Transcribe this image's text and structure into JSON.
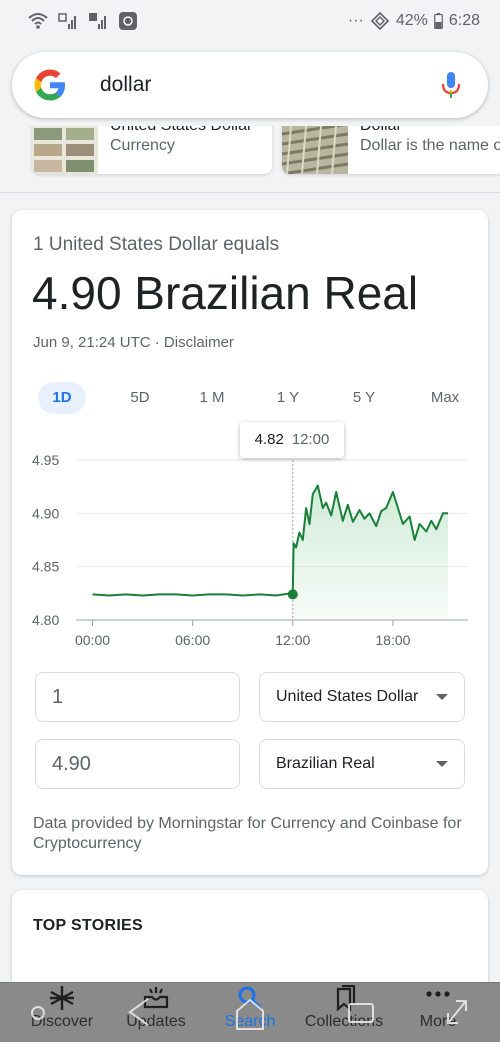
{
  "status_bar": {
    "battery": "42%",
    "time": "6:28",
    "dots": "···"
  },
  "search": {
    "query": "dollar"
  },
  "knowledge_cards": [
    {
      "title": "United States Dollar",
      "subtitle": "Currency"
    },
    {
      "title": "Dollar",
      "subtitle": "Dollar is the name o"
    }
  ],
  "converter": {
    "equals_text": "1 United States Dollar equals",
    "result_text": "4.90 Brazilian Real",
    "timestamp": "Jun 9, 21:24 UTC",
    "separator": "·",
    "disclaimer": "Disclaimer",
    "ranges": [
      "1D",
      "5D",
      "1 M",
      "1 Y",
      "5 Y",
      "Max"
    ],
    "active_range": "1D",
    "tooltip": {
      "value": "4.82",
      "time": "12:00"
    },
    "from_amount": "1",
    "from_currency": "United States Dollar",
    "to_amount": "4.90",
    "to_currency": "Brazilian Real",
    "attribution": "Data provided by Morningstar for Currency and Coinbase for Cryptocurrency"
  },
  "chart_data": {
    "type": "area",
    "x_tick_labels": [
      "00:00",
      "06:00",
      "12:00",
      "18:00"
    ],
    "y_tick_labels": [
      "4.95",
      "4.90",
      "4.85",
      "4.80"
    ],
    "ylim": [
      4.8,
      4.95
    ],
    "xlim_hours": [
      -0.75,
      22.5
    ],
    "grid": true,
    "highlight_point": {
      "hour": 12,
      "value": 4.824
    },
    "series": [
      {
        "x_hours": [
          0,
          1,
          2,
          3,
          4,
          5,
          6,
          7,
          8,
          9,
          10,
          11,
          11.9,
          12,
          12.05,
          12.2,
          12.4,
          12.6,
          12.8,
          13,
          13.2,
          13.5,
          13.8,
          14,
          14.3,
          14.6,
          15,
          15.3,
          15.6,
          16,
          16.3,
          16.6,
          17,
          17.3,
          17.6,
          18,
          18.3,
          18.6,
          19,
          19.3,
          19.6,
          20,
          20.3,
          20.6,
          21,
          21.3
        ],
        "values": [
          4.824,
          4.823,
          4.824,
          4.823,
          4.824,
          4.824,
          4.823,
          4.824,
          4.824,
          4.823,
          4.824,
          4.823,
          4.825,
          4.826,
          4.872,
          4.868,
          4.882,
          4.875,
          4.905,
          4.89,
          4.918,
          4.926,
          4.905,
          4.91,
          4.898,
          4.92,
          4.893,
          4.908,
          4.892,
          4.903,
          4.895,
          4.9,
          4.888,
          4.902,
          4.905,
          4.92,
          4.905,
          4.89,
          4.897,
          4.875,
          4.89,
          4.883,
          4.893,
          4.885,
          4.9,
          4.9
        ]
      }
    ],
    "line_color": "#188038",
    "fill_color": "#ceead6"
  },
  "top_stories": {
    "title": "TOP STORIES"
  },
  "bottom_nav": [
    {
      "label": "Discover",
      "icon": "asterisk-icon"
    },
    {
      "label": "Updates",
      "icon": "inbox-icon"
    },
    {
      "label": "Search",
      "icon": "search-icon"
    },
    {
      "label": "Collections",
      "icon": "bookmark-icon"
    },
    {
      "label": "More",
      "icon": "more-dots-icon"
    }
  ],
  "colors": {
    "accent": "#1a73e8",
    "chart_line": "#188038"
  }
}
